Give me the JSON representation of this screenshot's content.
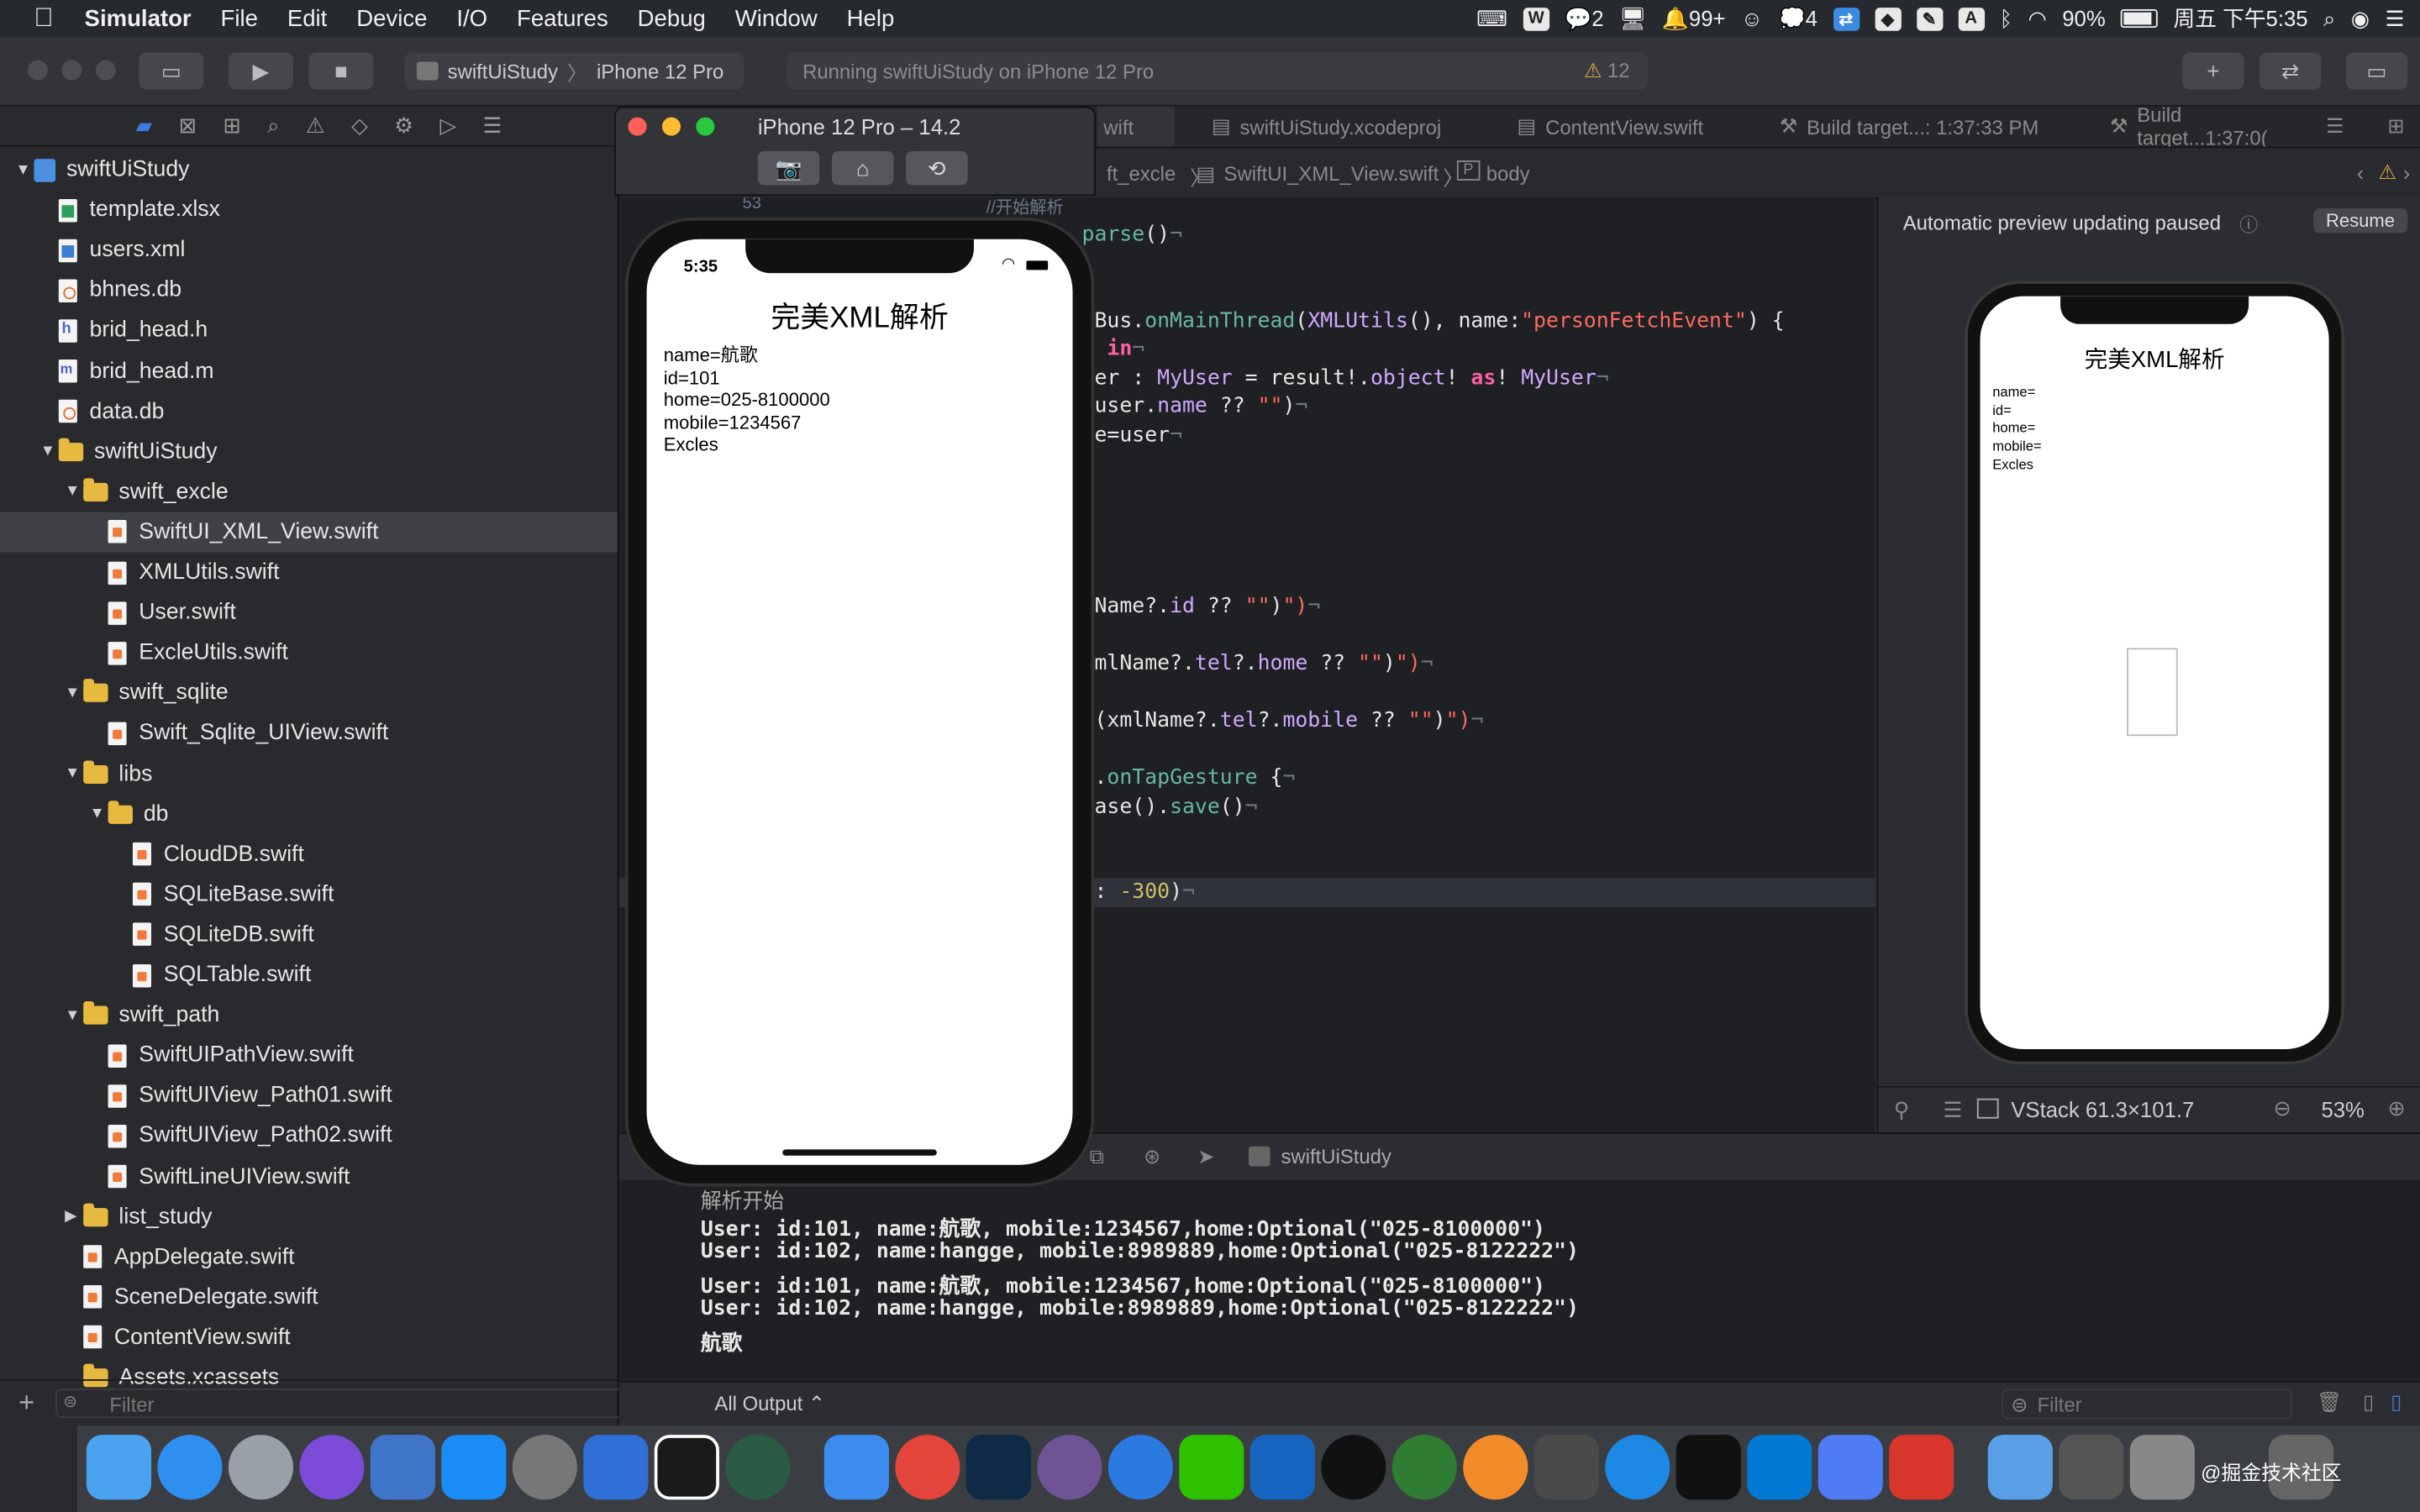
{
  "menubar": {
    "apple": "",
    "items": [
      "Simulator",
      "File",
      "Edit",
      "Device",
      "I/O",
      "Features",
      "Debug",
      "Window",
      "Help"
    ],
    "status": {
      "messages_count": "2",
      "notifications_count": "99+",
      "wechat_count": "4",
      "input_label": "A",
      "battery": "90%",
      "datetime": "周五 下午5:35"
    }
  },
  "toolbar": {
    "scheme": "swiftUiStudy",
    "destination": "iPhone 12 Pro",
    "activity": "Running swiftUiStudy on iPhone 12 Pro",
    "warning_count": "12"
  },
  "navigator": {
    "items": [
      {
        "label": "swiftUiStudy",
        "kind": "project",
        "level": 0,
        "expanded": true
      },
      {
        "label": "template.xlsx",
        "kind": "xlsx",
        "level": 1
      },
      {
        "label": "users.xml",
        "kind": "xml",
        "level": 1
      },
      {
        "label": "bhnes.db",
        "kind": "db",
        "level": 1
      },
      {
        "label": "brid_head.h",
        "kind": "h",
        "level": 1
      },
      {
        "label": "brid_head.m",
        "kind": "m",
        "level": 1
      },
      {
        "label": "data.db",
        "kind": "db",
        "level": 1
      },
      {
        "label": "swiftUiStudy",
        "kind": "folder",
        "level": 1,
        "expanded": true
      },
      {
        "label": "swift_excle",
        "kind": "folder",
        "level": 2,
        "expanded": true
      },
      {
        "label": "SwiftUI_XML_View.swift",
        "kind": "swift",
        "level": 3,
        "selected": true
      },
      {
        "label": "XMLUtils.swift",
        "kind": "swift",
        "level": 3
      },
      {
        "label": "User.swift",
        "kind": "swift",
        "level": 3
      },
      {
        "label": "ExcleUtils.swift",
        "kind": "swift",
        "level": 3
      },
      {
        "label": "swift_sqlite",
        "kind": "folder",
        "level": 2,
        "expanded": true
      },
      {
        "label": "Swift_Sqlite_UIView.swift",
        "kind": "swift",
        "level": 3
      },
      {
        "label": "libs",
        "kind": "folder",
        "level": 2,
        "expanded": true
      },
      {
        "label": "db",
        "kind": "folder",
        "level": 3,
        "expanded": true
      },
      {
        "label": "CloudDB.swift",
        "kind": "swift",
        "level": 4
      },
      {
        "label": "SQLiteBase.swift",
        "kind": "swift",
        "level": 4
      },
      {
        "label": "SQLiteDB.swift",
        "kind": "swift",
        "level": 4
      },
      {
        "label": "SQLTable.swift",
        "kind": "swift",
        "level": 4
      },
      {
        "label": "swift_path",
        "kind": "folder",
        "level": 2,
        "expanded": true
      },
      {
        "label": "SwiftUIPathView.swift",
        "kind": "swift",
        "level": 3
      },
      {
        "label": "SwiftUIView_Path01.swift",
        "kind": "swift",
        "level": 3
      },
      {
        "label": "SwiftUIView_Path02.swift",
        "kind": "swift",
        "level": 3
      },
      {
        "label": "SwiftLineUIView.swift",
        "kind": "swift",
        "level": 3
      },
      {
        "label": "list_study",
        "kind": "folder",
        "level": 2,
        "expanded": false
      },
      {
        "label": "AppDelegate.swift",
        "kind": "swift",
        "level": 2
      },
      {
        "label": "SceneDelegate.swift",
        "kind": "swift",
        "level": 2
      },
      {
        "label": "ContentView.swift",
        "kind": "swift",
        "level": 2
      },
      {
        "label": "Assets.xcassets",
        "kind": "folder",
        "level": 2
      }
    ],
    "filter_placeholder": "Filter"
  },
  "editor": {
    "tabs": [
      "wift",
      "swiftUiStudy.xcodeproj",
      "ContentView.swift",
      "Build target...: 1:37:33 PM",
      "Build target...1:37:0("
    ],
    "jumpbar": [
      "ft_excle",
      "SwiftUI_XML_View.swift",
      "body"
    ],
    "line_number": "53",
    "comment_fragment": "//开始解析"
  },
  "canvas": {
    "status": "Automatic preview updating paused",
    "resume": "Resume",
    "preview_title": "完美XML解析",
    "preview_lines": [
      "name=",
      "id=",
      "home=",
      "mobile=",
      "Excles"
    ],
    "selection_info": "VStack  61.3×101.7",
    "zoom": "53%"
  },
  "debugbar": {
    "process": "swiftUiStudy"
  },
  "console": {
    "lines": [
      "解析开始",
      "User: id:101, name:航歌, mobile:1234567,home:Optional(\"025-8100000\")",
      "User: id:102, name:hangge, mobile:8989889,home:Optional(\"025-8122222\")",
      "User: id:101, name:航歌, mobile:1234567,home:Optional(\"025-8100000\")",
      "User: id:102, name:hangge, mobile:8989889,home:Optional(\"025-8122222\")",
      "航歌"
    ],
    "output_selector": "All Output ⌃",
    "filter_placeholder": "Filter"
  },
  "simulator": {
    "title": "iPhone 12 Pro – 14.2",
    "time": "5:35",
    "app_title": "完美XML解析",
    "lines": [
      "name=航歌",
      "id=101",
      "home=025-8100000",
      "mobile=1234567",
      "Excles"
    ]
  },
  "watermark": "@掘金技术社区",
  "colors": {
    "accent": "#3d7bd9",
    "keyword": "#fc5fa3",
    "string": "#fc6a5d",
    "number": "#d0bf69"
  }
}
